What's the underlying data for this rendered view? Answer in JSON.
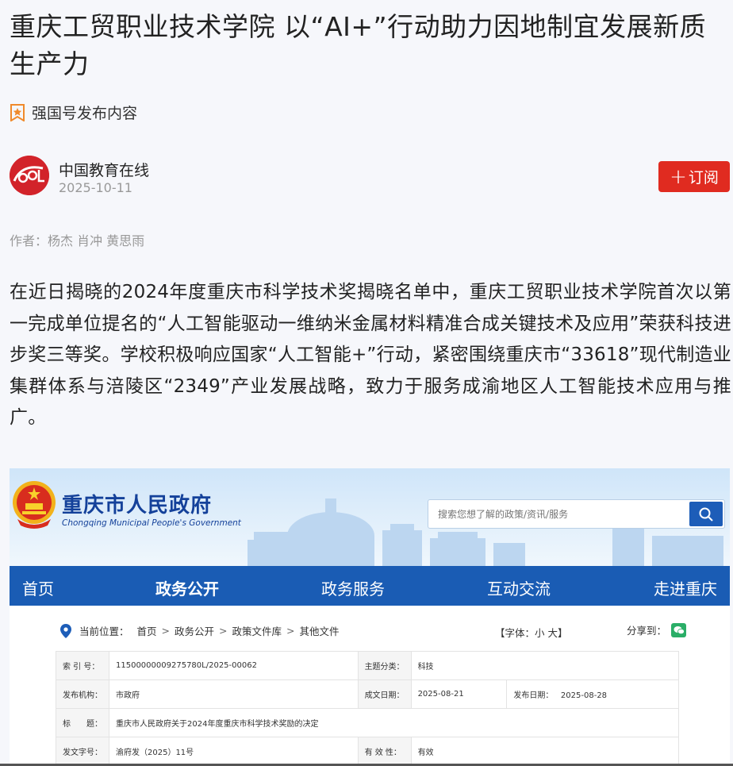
{
  "article": {
    "title": "重庆工贸职业技术学院 以“AI+”行动助力因地制宜发展新质生产力",
    "source_label": "强国号发布内容",
    "author_name": "中国教育在线",
    "date": "2025-10-11",
    "subscribe_label": "订阅",
    "byline": "作者：杨杰 肖冲 黄思雨",
    "body": "在近日揭晓的2024年度重庆市科学技术奖揭晓名单中，重庆工贸职业技术学院首次以第一完成单位提名的“人工智能驱动一维纳米金属材料精准合成关键技术及应用”荣获科技进步奖三等奖。学校积极响应国家“人工智能+”行动，紧密围绕重庆市“33618”现代制造业集群体系与涪陵区“2349”产业发展战略，致力于服务成渝地区人工智能技术应用与推广。"
  },
  "embedded_screenshot": {
    "gov_name": "重庆市人民政府",
    "gov_name_en": "Chongqing Municipal People's Government",
    "search_placeholder": "搜索您想了解的政策/资讯/服务",
    "nav": [
      "首页",
      "政务公开",
      "政务服务",
      "互动交流",
      "走进重庆"
    ],
    "breadcrumb": {
      "label": "当前位置：",
      "items": [
        "首页",
        "政务公开",
        "政策文件库",
        "其他文件"
      ]
    },
    "font_control": "【字体：小 大】",
    "share_label": "分享到：",
    "meta": {
      "index_label": "索 引 号：",
      "index_value": "11500000009275780L/2025-00062",
      "topic_label": "主题分类：",
      "topic_value": "科技",
      "issuer_label": "发布机构：",
      "issuer_value": "市政府",
      "created_label": "成文日期：",
      "created_value": "2025-08-21",
      "published_label": "发布日期：",
      "published_value": "2025-08-28",
      "subject_label": "标　　题：",
      "subject_value": "重庆市人民政府关于2024年度重庆市科学技术奖励的决定",
      "doc_no_label": "发文字号：",
      "doc_no_value": "渝府发（2025）11号",
      "validity_label": "有 效 性：",
      "validity_value": "有效"
    }
  },
  "colors": {
    "subscribe_red": "#e02b20",
    "gov_blue": "#1a5cb4",
    "gov_text_blue": "#14419a"
  }
}
